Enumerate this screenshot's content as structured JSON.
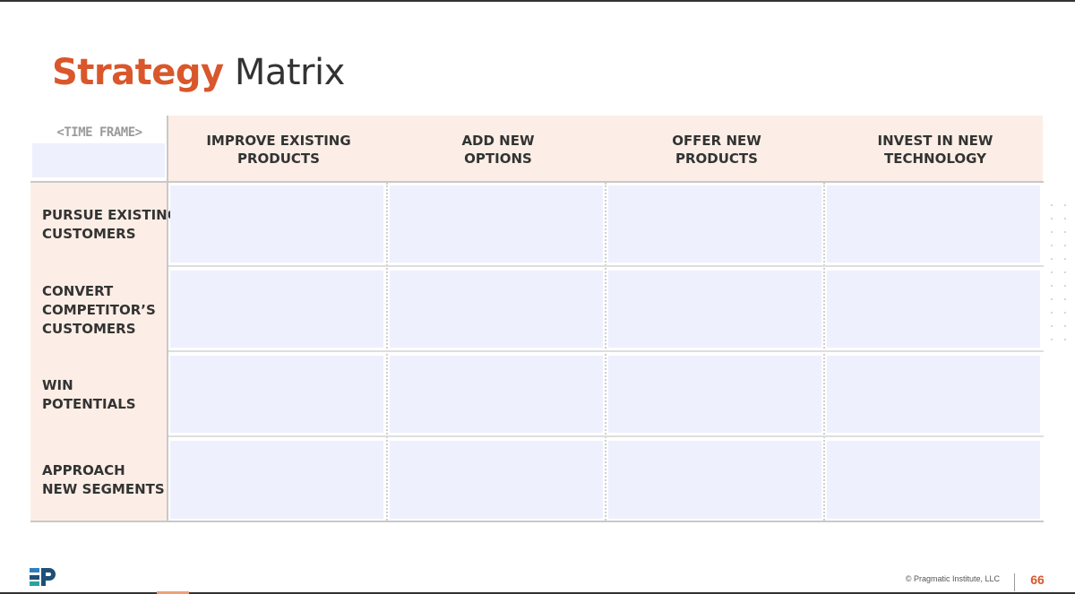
{
  "slide": {
    "title_accent": "Strategy",
    "title_rest": "Matrix"
  },
  "matrix": {
    "timeframe_label": "<TIME FRAME>",
    "columns": [
      {
        "line1": "IMPROVE EXISTING",
        "line2": "PRODUCTS"
      },
      {
        "line1": "ADD NEW",
        "line2": "OPTIONS"
      },
      {
        "line1": "OFFER NEW",
        "line2": "PRODUCTS"
      },
      {
        "line1": "INVEST IN NEW",
        "line2": "TECHNOLOGY"
      }
    ],
    "rows": [
      {
        "lines": [
          "PURSUE EXISTING",
          "CUSTOMERS"
        ]
      },
      {
        "lines": [
          "CONVERT",
          "COMPETITOR’S",
          "CUSTOMERS"
        ]
      },
      {
        "lines": [
          "WIN",
          "POTENTIALS"
        ]
      },
      {
        "lines": [
          "APPROACH",
          "NEW SEGMENTS"
        ]
      }
    ]
  },
  "footer": {
    "logo_icon": "pragmatic-logo-icon",
    "copyright": "© Pragmatic Institute, LLC",
    "page_number": "66"
  },
  "colors": {
    "accent": "#d9572b",
    "header_fill": "#fceee6",
    "cell_fill": "#eef0fd"
  }
}
